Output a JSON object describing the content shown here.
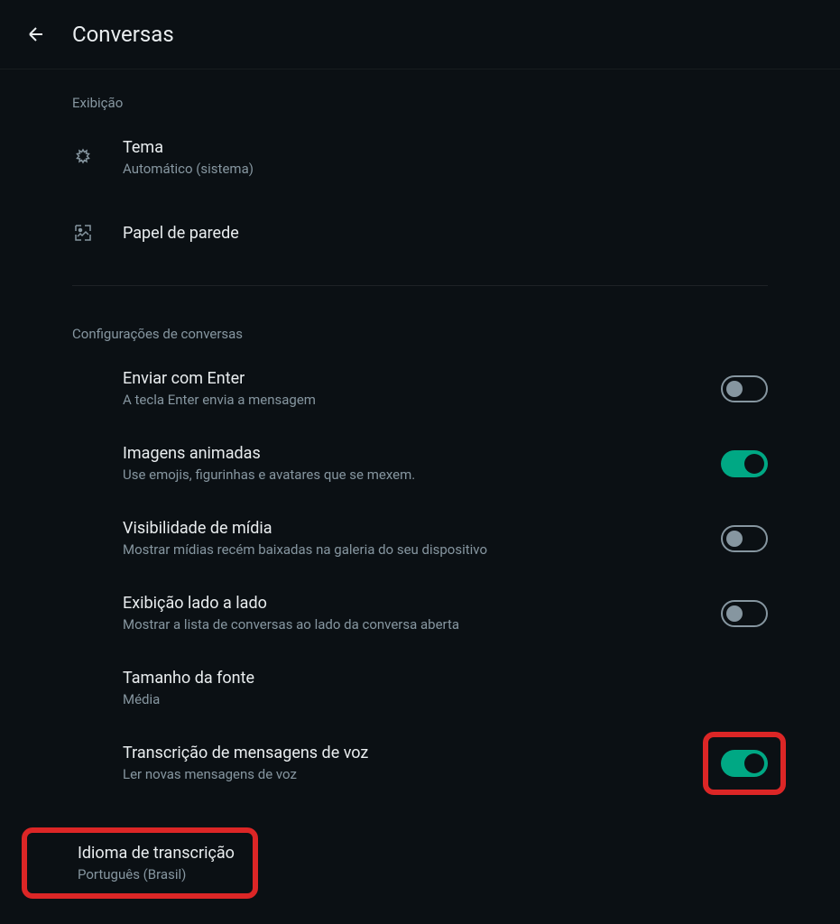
{
  "header": {
    "title": "Conversas"
  },
  "sections": {
    "display": {
      "label": "Exibição",
      "theme": {
        "title": "Tema",
        "subtitle": "Automático (sistema)"
      },
      "wallpaper": {
        "title": "Papel de parede"
      }
    },
    "chatSettings": {
      "label": "Configurações de conversas",
      "enterSend": {
        "title": "Enviar com Enter",
        "subtitle": "A tecla Enter envia a mensagem",
        "enabled": false
      },
      "animatedImages": {
        "title": "Imagens animadas",
        "subtitle": "Use emojis, figurinhas e avatares que se mexem.",
        "enabled": true
      },
      "mediaVisibility": {
        "title": "Visibilidade de mídia",
        "subtitle": "Mostrar mídias recém baixadas na galeria do seu dispositivo",
        "enabled": false
      },
      "sideBySide": {
        "title": "Exibição lado a lado",
        "subtitle": "Mostrar a lista de conversas ao lado da conversa aberta",
        "enabled": false
      },
      "fontSize": {
        "title": "Tamanho da fonte",
        "subtitle": "Média"
      },
      "voiceTranscription": {
        "title": "Transcrição de mensagens de voz",
        "subtitle": "Ler novas mensagens de voz",
        "enabled": true
      },
      "transcriptionLanguage": {
        "title": "Idioma de transcrição",
        "subtitle": "Português (Brasil)"
      }
    }
  }
}
